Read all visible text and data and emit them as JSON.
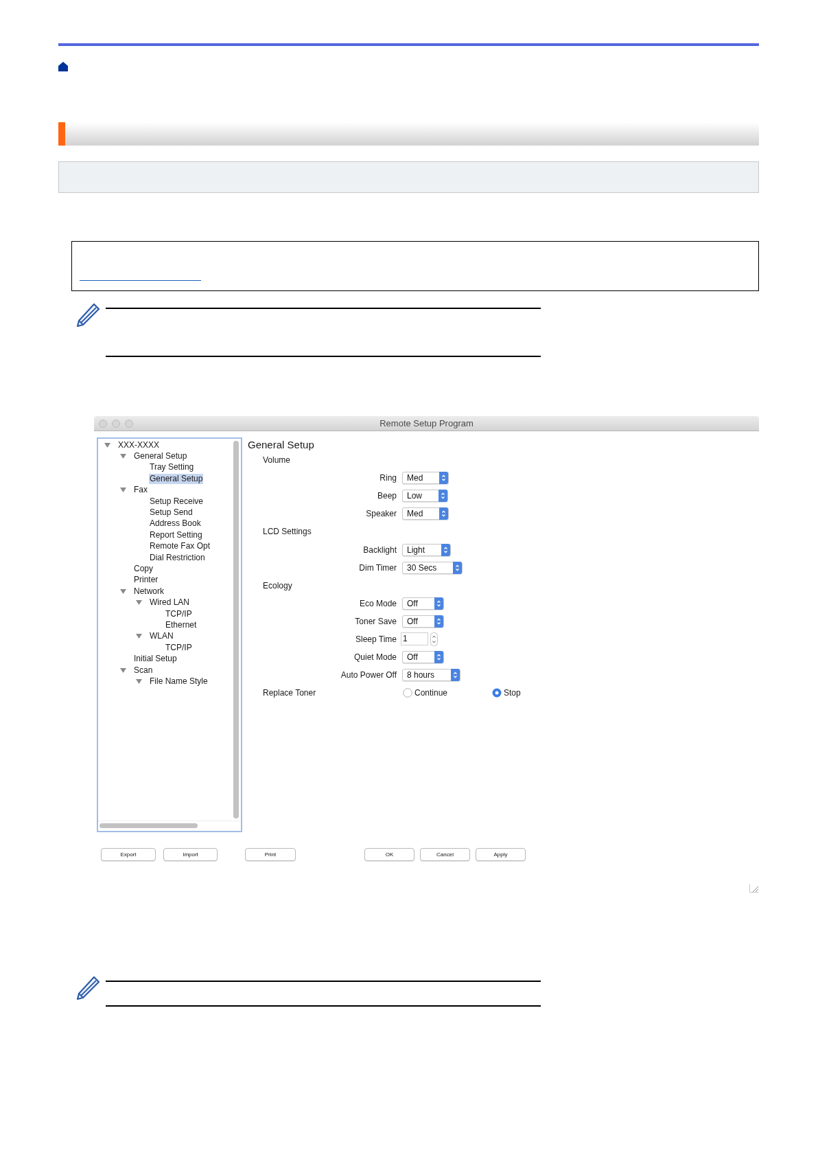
{
  "window": {
    "title": "Remote Setup Program"
  },
  "tree": [
    {
      "label": "XXX-XXXX",
      "expanded": true,
      "selected": false,
      "children": [
        {
          "label": "General Setup",
          "expanded": true,
          "selected": false,
          "children": [
            {
              "label": "Tray Setting",
              "selected": false
            },
            {
              "label": "General Setup",
              "selected": true
            }
          ]
        },
        {
          "label": "Fax",
          "expanded": true,
          "selected": false,
          "children": [
            {
              "label": "Setup Receive",
              "selected": false
            },
            {
              "label": "Setup Send",
              "selected": false
            },
            {
              "label": "Address Book",
              "selected": false
            },
            {
              "label": "Report Setting",
              "selected": false
            },
            {
              "label": "Remote Fax Opt",
              "selected": false
            },
            {
              "label": "Dial Restriction",
              "selected": false
            }
          ]
        },
        {
          "label": "Copy",
          "selected": false
        },
        {
          "label": "Printer",
          "selected": false
        },
        {
          "label": "Network",
          "expanded": true,
          "selected": false,
          "children": [
            {
              "label": "Wired LAN",
              "expanded": true,
              "selected": false,
              "children": [
                {
                  "label": "TCP/IP",
                  "selected": false
                },
                {
                  "label": "Ethernet",
                  "selected": false
                }
              ]
            },
            {
              "label": "WLAN",
              "expanded": true,
              "selected": false,
              "children": [
                {
                  "label": "TCP/IP",
                  "selected": false
                }
              ]
            }
          ]
        },
        {
          "label": "Initial Setup",
          "selected": false
        },
        {
          "label": "Scan",
          "expanded": true,
          "selected": false,
          "children": [
            {
              "label": "File Name Style",
              "expanded": true,
              "selected": false
            }
          ]
        }
      ]
    }
  ],
  "settings": {
    "title": "General Setup",
    "groups": [
      {
        "kind": "section",
        "label": "Volume",
        "fields": [
          {
            "kind": "dropdown",
            "label": "Ring",
            "value": "Med"
          },
          {
            "kind": "dropdown",
            "label": "Beep",
            "value": "Low"
          },
          {
            "kind": "dropdown",
            "label": "Speaker",
            "value": "Med"
          }
        ]
      },
      {
        "kind": "section",
        "label": "LCD Settings",
        "fields": [
          {
            "kind": "dropdown",
            "label": "Backlight",
            "value": "Light"
          },
          {
            "kind": "dropdown",
            "label": "Dim Timer",
            "value": "30 Secs"
          }
        ]
      },
      {
        "kind": "section",
        "label": "Ecology",
        "fields": [
          {
            "kind": "dropdown",
            "label": "Eco Mode",
            "value": "Off"
          },
          {
            "kind": "dropdown",
            "label": "Toner Save",
            "value": "Off"
          },
          {
            "kind": "stepper",
            "label": "Sleep Time",
            "value": "1"
          },
          {
            "kind": "dropdown",
            "label": "Quiet Mode",
            "value": "Off"
          },
          {
            "kind": "dropdown",
            "label": "Auto Power Off",
            "value": "8 hours"
          }
        ]
      },
      {
        "kind": "radio",
        "label": "Replace Toner",
        "options": [
          {
            "label": "Continue",
            "selected": false
          },
          {
            "label": "Stop",
            "selected": true
          }
        ]
      }
    ]
  },
  "buttons": [
    {
      "label": "Export"
    },
    {
      "label": "Import"
    },
    {
      "label": "Print"
    },
    {
      "label": "OK"
    },
    {
      "label": "Cancel"
    },
    {
      "label": "Apply"
    }
  ]
}
